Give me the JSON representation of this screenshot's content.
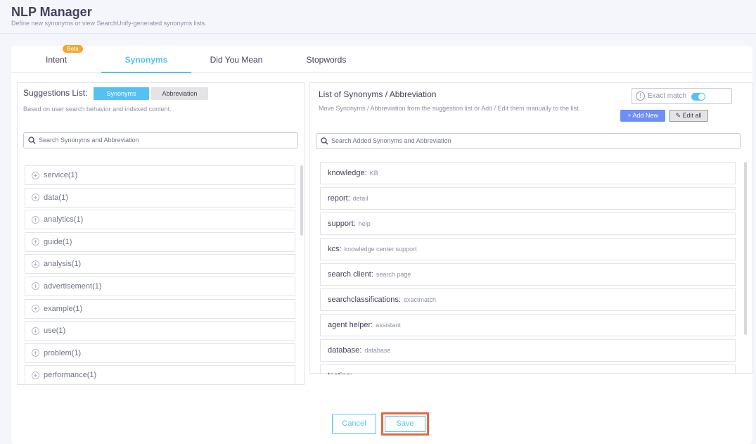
{
  "header": {
    "title": "NLP Manager",
    "subtitle": "Define new synonyms or view SearchUnify-generated synonyms lists."
  },
  "tabs": [
    {
      "label": "Intent",
      "badge": "Beta"
    },
    {
      "label": "Synonyms",
      "active": true
    },
    {
      "label": "Did You Mean"
    },
    {
      "label": "Stopwords"
    }
  ],
  "suggestions": {
    "label": "Suggestions List:",
    "toggle_on": "Synonyms",
    "toggle_off": "Abbreviation",
    "hint": "Based on user search behavior and indexed content.",
    "search_placeholder": "Search Synonyms and Abbreviation",
    "items": [
      "service(1)",
      "data(1)",
      "analytics(1)",
      "guide(1)",
      "analysis(1)",
      "advertisement(1)",
      "example(1)",
      "use(1)",
      "problem(1)",
      "performance(1)"
    ]
  },
  "synonyms": {
    "title": "List of Synonyms / Abbreviation",
    "hint": "Move Synonyms / Abbreviation from the suggestion list or Add / Edit them manually to the list.",
    "exact_match_label": "Exact match",
    "exact_match_on": true,
    "info_glyph": "!",
    "add_new": "+ Add New",
    "edit_all": "Edit all",
    "search_placeholder": "Search Added Synonyms and Abbreviation",
    "items": [
      {
        "key": "knowledge:",
        "value": "KB"
      },
      {
        "key": "report:",
        "value": "detail"
      },
      {
        "key": "support:",
        "value": "help"
      },
      {
        "key": "kcs:",
        "value": "knowledge center support"
      },
      {
        "key": "search client:",
        "value": "search page"
      },
      {
        "key": "searchclassifications:",
        "value": "exactmatch"
      },
      {
        "key": "agent helper:",
        "value": "assistant"
      },
      {
        "key": "database:",
        "value": "database"
      },
      {
        "key": "testing:",
        "value": ""
      }
    ]
  },
  "footer": {
    "cancel": "Cancel",
    "save": "Save"
  },
  "colors": {
    "accent": "#55c1f2",
    "beta": "#f4a531",
    "add_button": "#6d8ef5",
    "highlight": "#e06a45"
  }
}
